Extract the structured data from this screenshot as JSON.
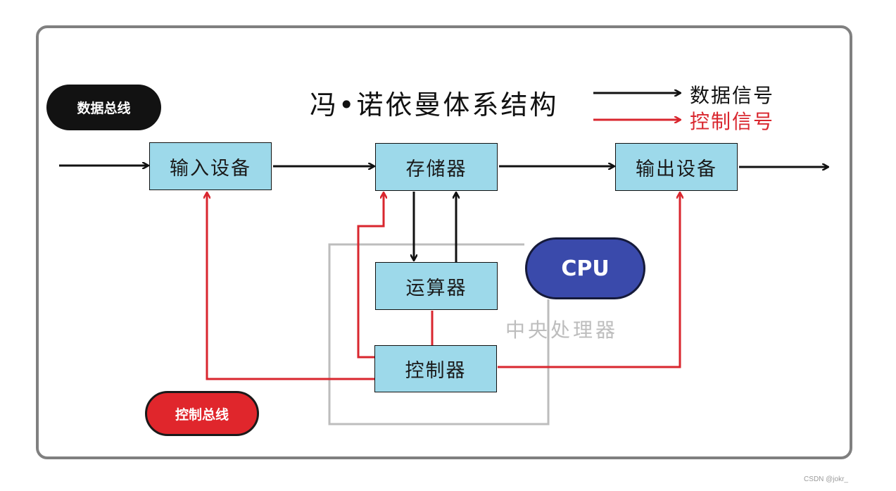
{
  "title": "冯•诺依曼体系结构",
  "legend": {
    "data_signal": {
      "label": "数据信号",
      "color": "#111111"
    },
    "control_signal": {
      "label": "控制信号",
      "color": "#d9262e"
    }
  },
  "buses": {
    "data_bus": {
      "label": "数据总线",
      "color": "#111111"
    },
    "control_bus": {
      "label": "控制总线",
      "color": "#e0262c"
    }
  },
  "components": {
    "input_device": "输入设备",
    "memory": "存储器",
    "output_device": "输出设备",
    "alu": "运算器",
    "controller": "控制器"
  },
  "cpu": {
    "badge": "CPU",
    "badge_color": "#3a4aab",
    "group_label": "中央处理器"
  },
  "colors": {
    "box_fill": "#9dd9ea",
    "frame": "#808080",
    "cpu_group_border": "#bdbdbd"
  },
  "watermark": "CSDN @jokr_"
}
